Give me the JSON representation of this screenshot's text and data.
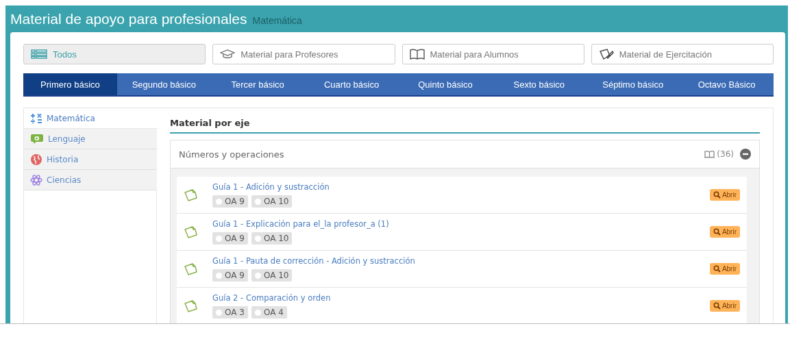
{
  "header": {
    "title": "Material de apoyo para profesionales",
    "subtitle": "Matemática"
  },
  "filters": [
    {
      "kind": "all",
      "label": "Todos",
      "selected": true
    },
    {
      "kind": "teacher",
      "label": "Material para Profesores",
      "selected": false
    },
    {
      "kind": "student",
      "label": "Material para Alumnos",
      "selected": false
    },
    {
      "kind": "exercise",
      "label": "Material de Ejercitación",
      "selected": false
    }
  ],
  "grades": [
    {
      "label": "Primero básico",
      "selected": true
    },
    {
      "label": "Segundo básico",
      "selected": false
    },
    {
      "label": "Tercer básico",
      "selected": false
    },
    {
      "label": "Cuarto básico",
      "selected": false
    },
    {
      "label": "Quinto básico",
      "selected": false
    },
    {
      "label": "Sexto básico",
      "selected": false
    },
    {
      "label": "Séptimo básico",
      "selected": false
    },
    {
      "label": "Octavo Básico",
      "selected": false
    }
  ],
  "subjects": [
    {
      "kind": "math",
      "label": "Matemática",
      "selected": true
    },
    {
      "kind": "language",
      "label": "Lenguaje",
      "selected": false
    },
    {
      "kind": "history",
      "label": "Historia",
      "selected": false
    },
    {
      "kind": "science",
      "label": "Ciencias",
      "selected": false
    }
  ],
  "section_title": "Material por eje",
  "axis": {
    "title": "Números y operaciones",
    "count": "(36)",
    "expanded": true,
    "items": [
      {
        "title": "Guía 1 - Adición y sustracción",
        "tags": [
          "OA 9",
          "OA 10"
        ],
        "action": "Abrir"
      },
      {
        "title": "Guía 1 - Explicación para el_la profesor_a (1)",
        "tags": [
          "OA 9",
          "OA 10"
        ],
        "action": "Abrir"
      },
      {
        "title": "Guía 1 - Pauta de corrección - Adición y sustracción",
        "tags": [
          "OA 9",
          "OA 10"
        ],
        "action": "Abrir"
      },
      {
        "title": "Guía 2 - Comparación y orden",
        "tags": [
          "OA 3",
          "OA 4"
        ],
        "action": "Abrir"
      }
    ]
  }
}
